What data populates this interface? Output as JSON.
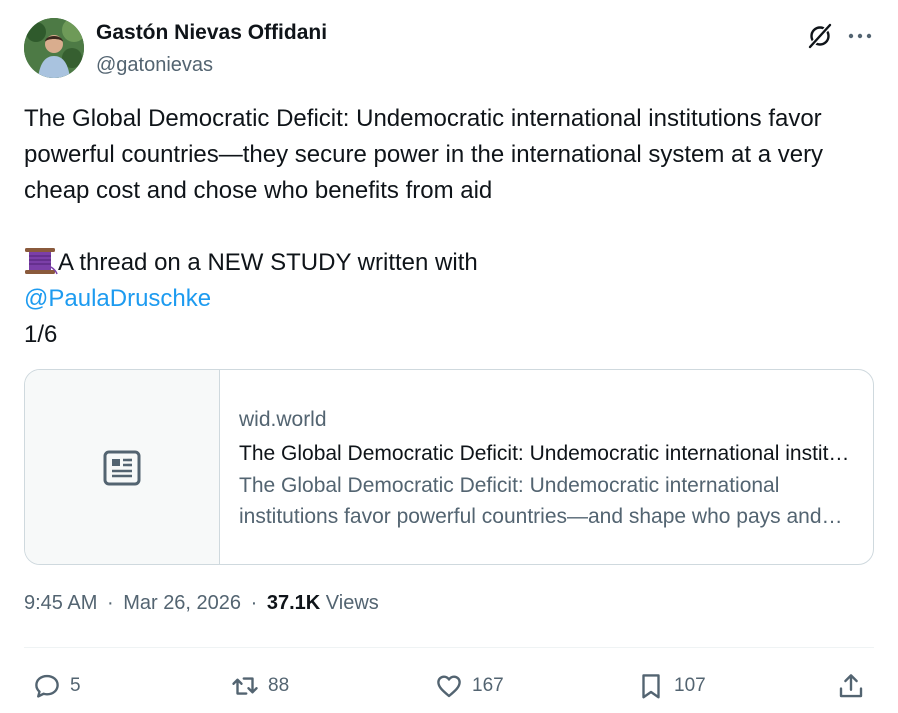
{
  "author": {
    "name": "Gastón Nievas Offidani",
    "handle": "@gatonievas"
  },
  "tweet": {
    "line1": "The Global Democratic Deficit: Undemocratic international institutions favor",
    "line2": "powerful countries—they secure power in the international system at a very",
    "line3": "cheap cost and chose who benefits from aid",
    "thread_text": "A thread on a NEW STUDY written with",
    "mention": "@PaulaDruschke",
    "counter": "1/6"
  },
  "card": {
    "domain": "wid.world",
    "title": "The Global Democratic Deficit: Undemocratic international institutions favor powerful countries",
    "description": "The Global Democratic Deficit: Undemocratic international institutions favor powerful countries—and shape who pays and who benefits"
  },
  "meta": {
    "time": "9:45 AM",
    "separator": "·",
    "date": "Mar 26, 2026",
    "views_count": "37.1K",
    "views_label": "Views"
  },
  "actions": {
    "replies": "5",
    "reposts": "88",
    "likes": "167",
    "bookmarks": "107"
  },
  "icons": {
    "grok": "grok-icon",
    "more": "more-icon",
    "spool": "spool-of-thread-emoji",
    "article": "article-icon",
    "reply": "reply-icon",
    "repost": "repost-icon",
    "like": "heart-icon",
    "bookmark": "bookmark-icon",
    "share": "share-icon"
  },
  "colors": {
    "text": "#0f1419",
    "secondary": "#536471",
    "link": "#1d9bf0",
    "border": "#cfd9de"
  }
}
